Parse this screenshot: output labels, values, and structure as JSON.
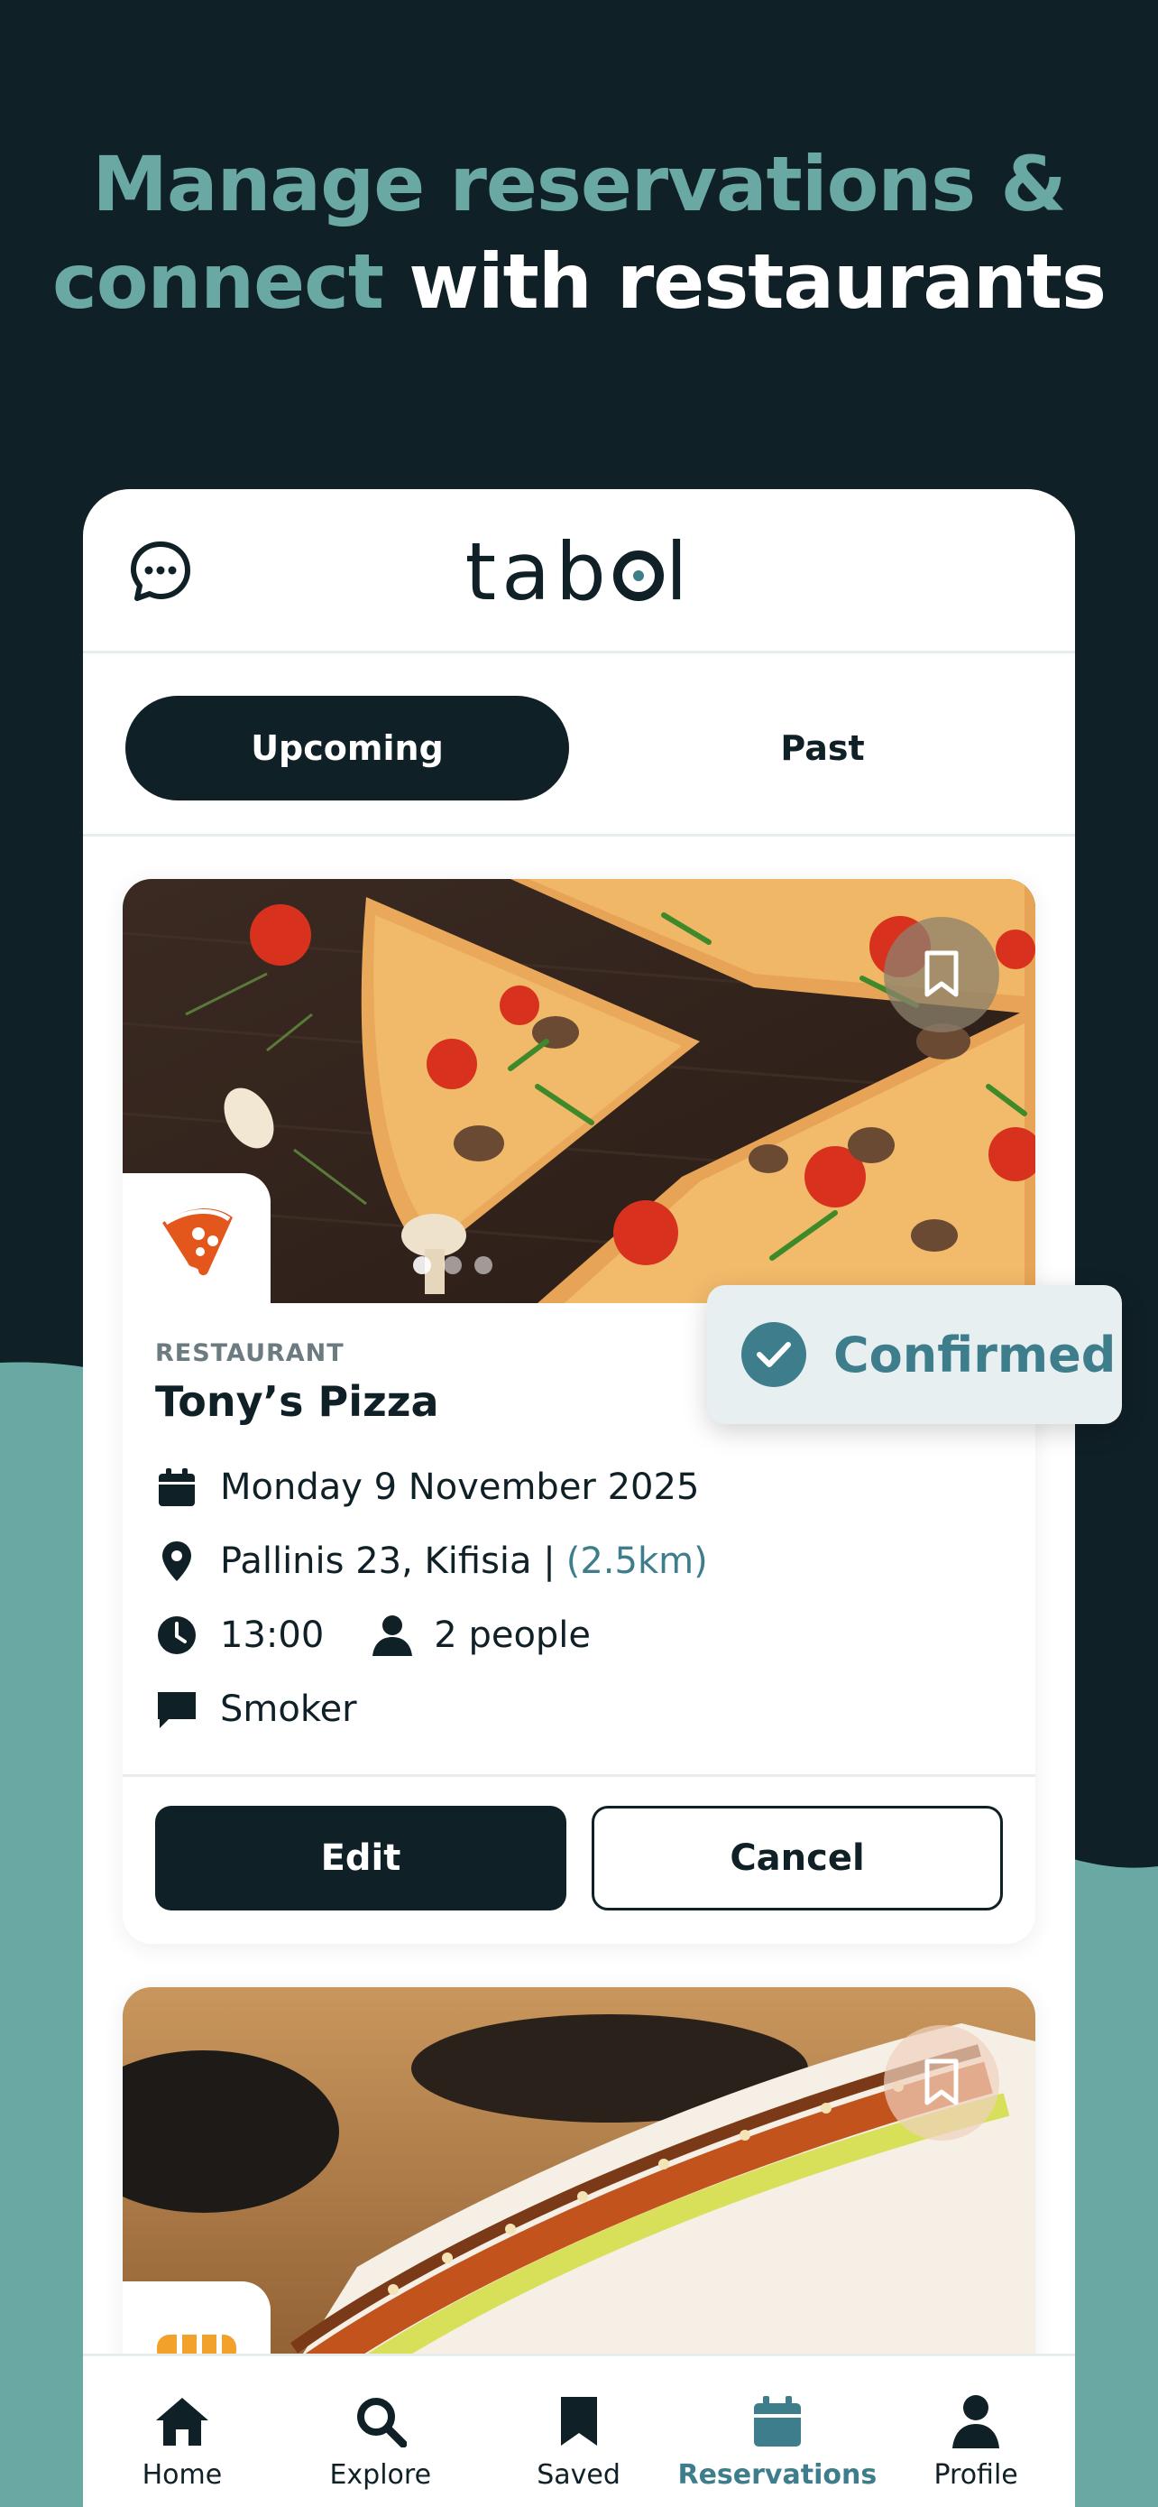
{
  "headline": {
    "line1": "Manage reservations &",
    "line2_accent": "connect",
    "line2_rest": "with restaurants"
  },
  "app": {
    "logo_text_1": "tab",
    "logo_text_2": "l"
  },
  "tabs": [
    {
      "label": "Upcoming",
      "active": true
    },
    {
      "label": "Past",
      "active": false
    }
  ],
  "reservation": {
    "category": "RESTAURANT",
    "name": "Tony’s Pizza",
    "date": "Monday 9 November 2025",
    "address": "Pallinis 23, Kifisia |",
    "distance": "(2.5km)",
    "time": "13:00",
    "people": "2 people",
    "note": "Smoker",
    "status": "Confirmed",
    "edit_label": "Edit",
    "cancel_label": "Cancel"
  },
  "nav": [
    {
      "label": "Home",
      "icon": "home-icon",
      "active": false
    },
    {
      "label": "Explore",
      "icon": "search-icon",
      "active": false
    },
    {
      "label": "Saved",
      "icon": "bookmark-icon",
      "active": false
    },
    {
      "label": "Reservations",
      "icon": "calendar-icon",
      "active": true
    },
    {
      "label": "Profile",
      "icon": "user-icon",
      "active": false
    }
  ],
  "colors": {
    "dark": "#102027",
    "teal": "#6aa8a3",
    "accent": "#3e7e8c",
    "white": "#ffffff"
  }
}
